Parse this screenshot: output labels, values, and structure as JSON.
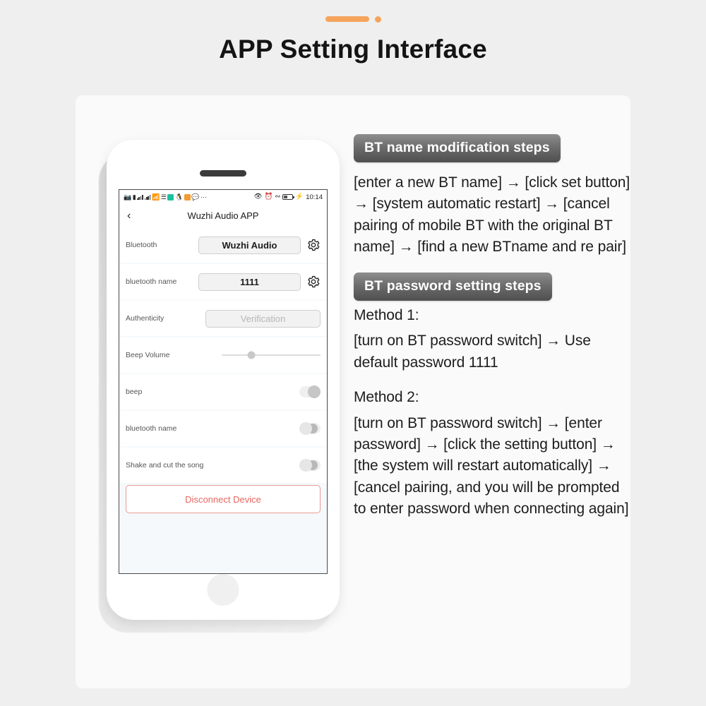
{
  "header": {
    "title": "APP Setting Interface",
    "accent_color": "#f6a45c"
  },
  "phone": {
    "statusbar": {
      "icons_left": [
        "camera-icon",
        "battery-small-icon",
        "signal-1-icon",
        "signal-2-icon",
        "wifi-icon",
        "wifi-off-icon",
        "app-teal-icon",
        "qq-penguin-icon",
        "mail-icon",
        "chat-bubble-icon",
        "more-icon"
      ],
      "icons_right": [
        "eye-icon",
        "alarm-icon",
        "bluetooth-icon",
        "battery-icon",
        "charging-bolt-icon"
      ],
      "time": "10:14"
    },
    "appbar": {
      "back": "‹",
      "title": "Wuzhi Audio APP"
    },
    "rows": [
      {
        "label": "Bluetooth",
        "value": "Wuzhi Audio",
        "control": "field-gear"
      },
      {
        "label": "bluetooth name",
        "value": "1111",
        "control": "field-gear"
      },
      {
        "label": "Authenticity",
        "value": "Verification",
        "control": "field-placeholder"
      },
      {
        "label": "Beep Volume",
        "value": "",
        "control": "slider"
      },
      {
        "label": "beep",
        "value": "",
        "control": "toggle-on"
      },
      {
        "label": "bluetooth name",
        "value": "",
        "control": "toggle-off"
      },
      {
        "label": "Shake and cut the song",
        "value": "",
        "control": "toggle-off"
      }
    ],
    "disconnect_label": "Disconnect Device",
    "disconnect_color": "#e8665f"
  },
  "panel": {
    "section1": {
      "badge": "BT name modification steps",
      "body": "[enter a new BT name] → [click set button] → [system automatic restart] → [cancel pairing of mobile BT with the original BT name] → [find a new BTname and re pair]"
    },
    "section2": {
      "badge": "BT password setting steps",
      "method1_title": "Method 1:",
      "method1_body": "[turn on BT password switch] → Use default password 1111",
      "method2_title": "Method 2:",
      "method2_body": "[turn on BT password switch] → [enter password] → [click the setting button] → [the system will restart automatically] → [cancel pairing, and you will be prompted to enter password when connecting again]"
    }
  }
}
